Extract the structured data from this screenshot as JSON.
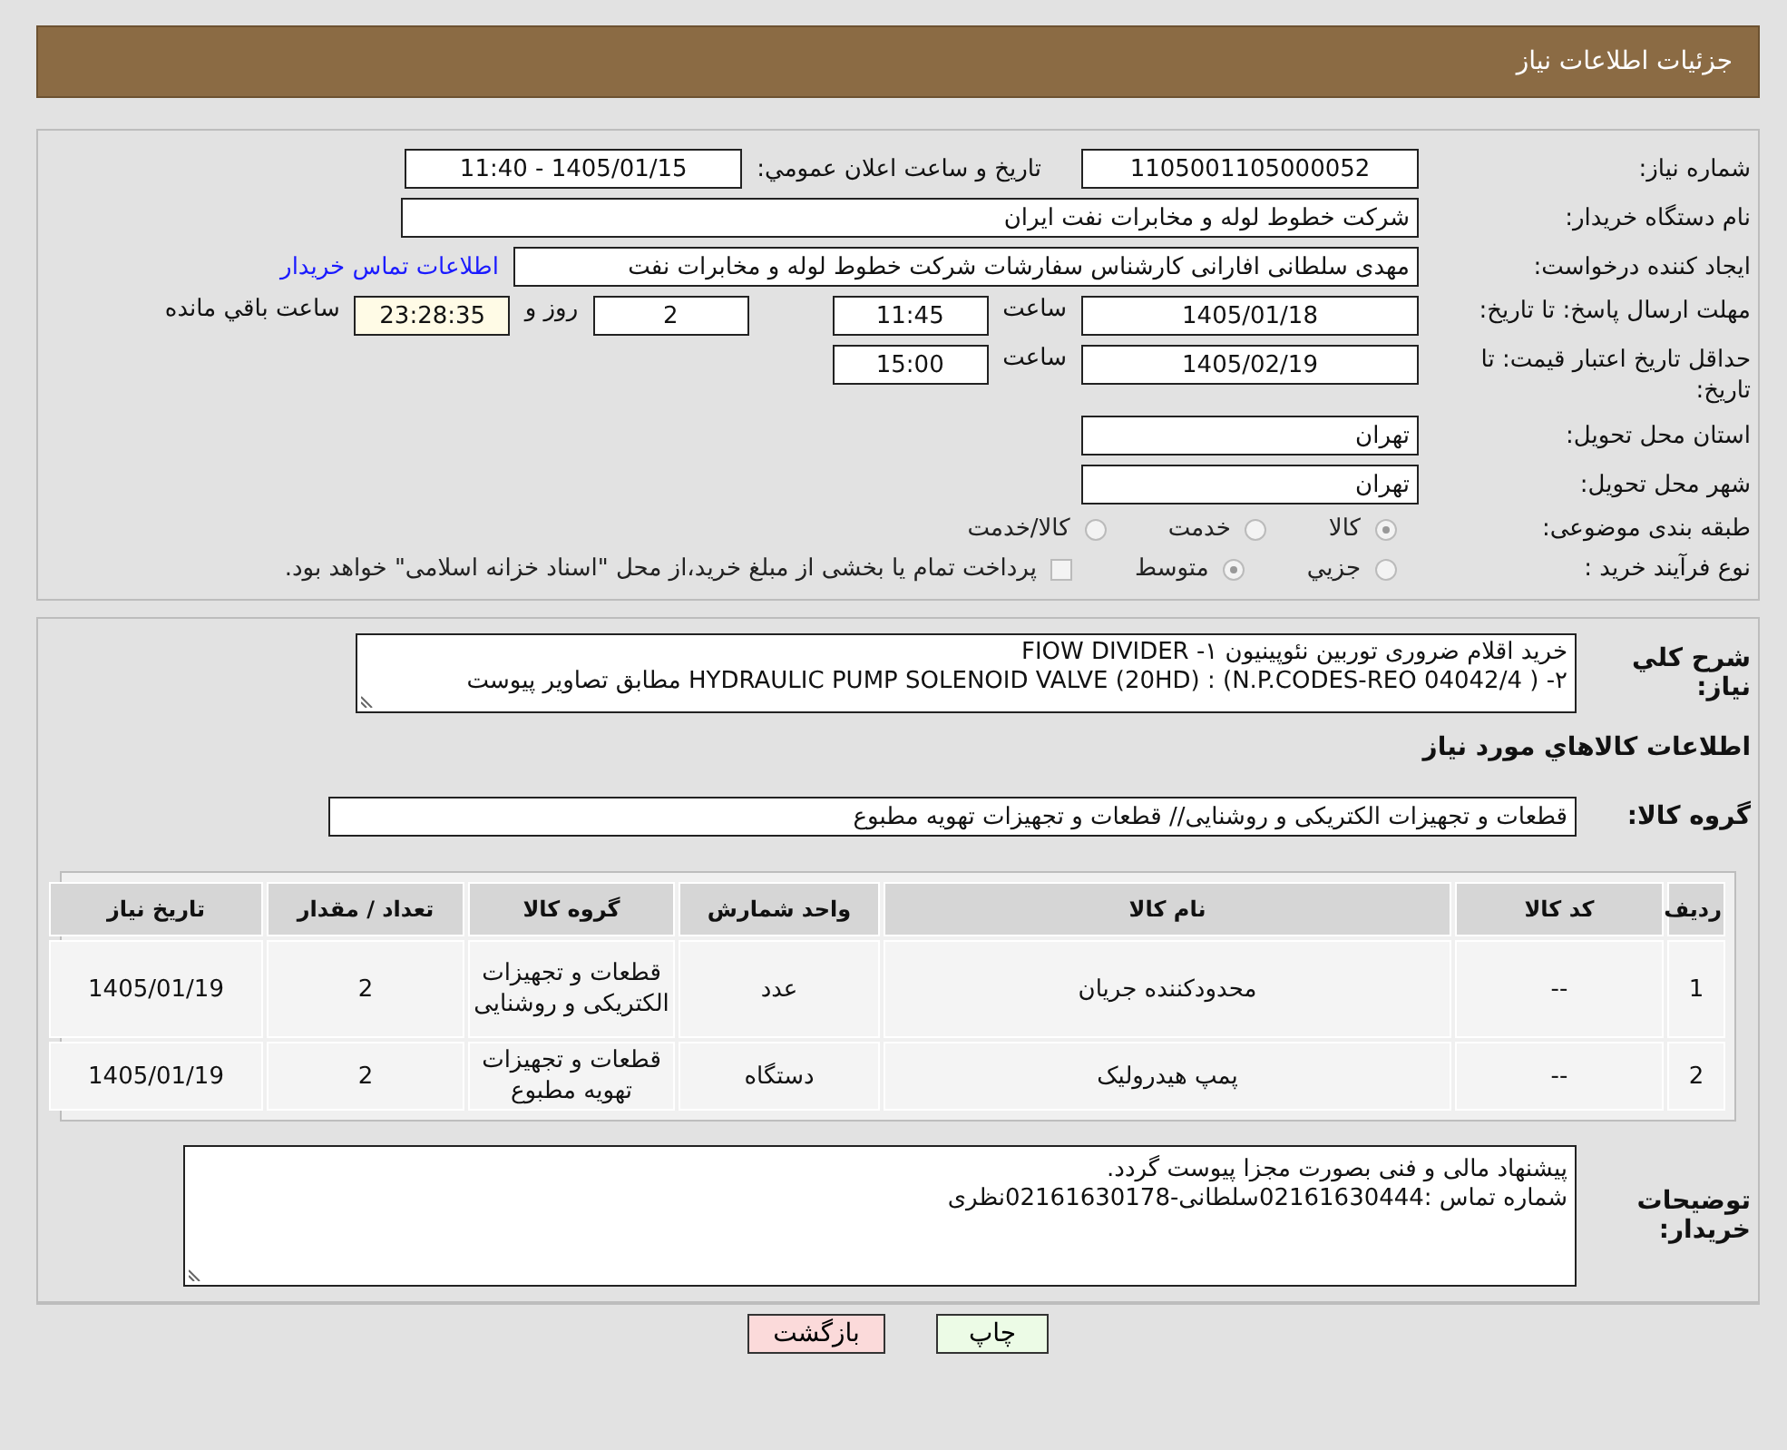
{
  "header": {
    "title": "جزئیات اطلاعات نیاز"
  },
  "need_number": {
    "label": "شماره نیاز:",
    "value": "1105001105000052"
  },
  "announce": {
    "label": "تاریخ و ساعت اعلان عمومي:",
    "value": "1405/01/15 - 11:40"
  },
  "buyer": {
    "label": "نام دستگاه خریدار:",
    "value": "شرکت خطوط لوله و مخابرات نفت ایران"
  },
  "requester": {
    "label": "ایجاد کننده درخواست:",
    "value": "مهدی سلطانی افارانی کارشناس سفارشات  شرکت خطوط لوله و مخابرات نفت",
    "link": "اطلاعات تماس خریدار"
  },
  "reply_deadline": {
    "label": "مهلت ارسال پاسخ: تا تاریخ:",
    "date": "1405/01/18",
    "time_label": "ساعت",
    "time": "11:45",
    "days": "2",
    "days_label": "روز و",
    "remaining": "23:28:35",
    "remaining_label": "ساعت باقي مانده"
  },
  "price_validity": {
    "label": "حداقل تاریخ اعتبار قیمت: تا تاریخ:",
    "date": "1405/02/19",
    "time_label": "ساعت",
    "time": "15:00"
  },
  "province": {
    "label": "استان محل تحویل:",
    "value": "تهران"
  },
  "city": {
    "label": "شهر محل تحویل:",
    "value": "تهران"
  },
  "category": {
    "label": "طبقه بندی موضوعی:",
    "options": [
      {
        "label": "کالا",
        "selected": true
      },
      {
        "label": "خدمت",
        "selected": false
      },
      {
        "label": "کالا/خدمت",
        "selected": false
      }
    ]
  },
  "process": {
    "label": "نوع فرآیند خرید :",
    "options": [
      {
        "label": "جزيي",
        "selected": false
      },
      {
        "label": "متوسط",
        "selected": true
      }
    ],
    "payment": {
      "label": "پرداخت تمام یا بخشی از مبلغ خرید،از محل \"اسناد خزانه اسلامی\" خواهد بود.",
      "checked": false
    }
  },
  "description": {
    "label": "شرح کلي نیاز:",
    "lines": [
      "خرید اقلام ضروری توربین نئوپینیون ۱-  FIOW DIVIDER",
      "۲- ( N.P.CODES-REO 04042/4) : HYDRAULIC PUMP SOLENOID VALVE (20HD) مطابق تصاویر پیوست"
    ]
  },
  "goods_heading": "اطلاعات کالاهاي مورد نیاز",
  "goods_group": {
    "label": "گروه کالا:",
    "value": "قطعات و تجهیزات الکتریکی و روشنایی//  قطعات و تجهیزات تهویه مطبوع"
  },
  "table": {
    "columns": [
      "ردیف",
      "کد کالا",
      "نام کالا",
      "واحد شمارش",
      "گروه کالا",
      "تعداد / مقدار",
      "تاریخ نیاز"
    ],
    "rows": [
      [
        "1",
        "--",
        "محدودکننده جریان",
        "عدد",
        "قطعات و تجهیزات الکتریکی و روشنایی",
        "2",
        "1405/01/19"
      ],
      [
        "2",
        "--",
        "پمپ هیدرولیک",
        "دستگاه",
        "قطعات و تجهیزات تهویه مطبوع",
        "2",
        "1405/01/19"
      ]
    ]
  },
  "buyer_notes": {
    "label": "توضیحات خریدار:",
    "lines": [
      "پیشنهاد  مالی  و فنی بصورت مجزا پیوست گردد.",
      "شماره تماس :02161630444سلطانی-02161630178نظری"
    ]
  },
  "buttons": [
    {
      "label": "چاپ",
      "kind": "print"
    },
    {
      "label": "بازگشت",
      "kind": "back"
    }
  ]
}
